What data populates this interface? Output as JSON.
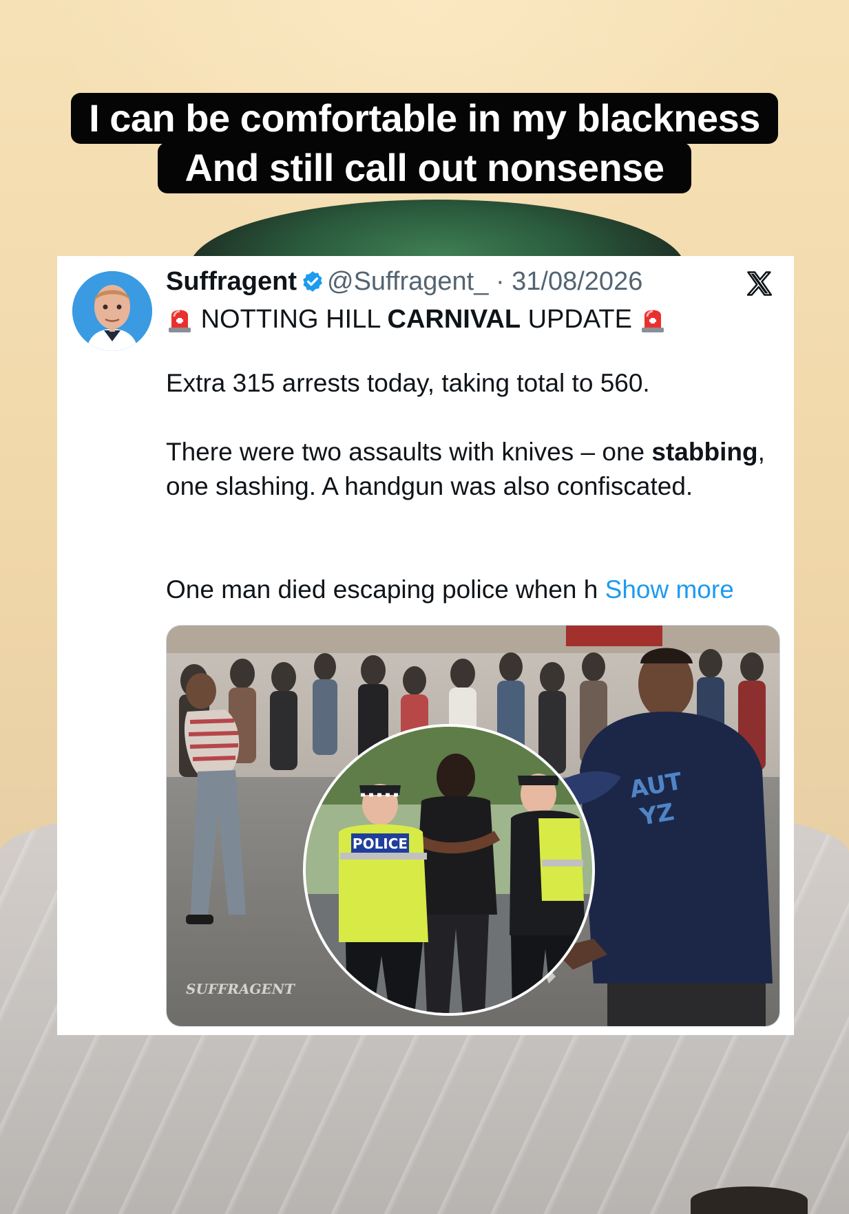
{
  "caption": {
    "line1": "I can be comfortable in my blackness",
    "line2": "And still call out nonsense"
  },
  "tweet": {
    "author_name": "Suffragent",
    "author_handle": "@Suffragent_",
    "date": "· 31/08/2026",
    "headline_part1": "NOTTING HILL ",
    "headline_bold": "CARNIVAL",
    "headline_part2": " UPDATE",
    "paragraph1": "Extra 315 arrests today, taking total to 560.",
    "paragraph2_part1": "There were two assaults with knives – one ",
    "paragraph2_bold": "stabbing",
    "paragraph2_part2": ", one slashing. A handgun was also confiscated.",
    "paragraph3": "One man died escaping police when h",
    "show_more": "Show more",
    "image_watermark": "SUFFRAGENT",
    "police_label": "POLICE"
  },
  "icons": {
    "verified": "verified-badge-icon",
    "x_logo": "x-logo-icon",
    "siren": "siren-emoji-icon"
  },
  "colors": {
    "caption_bg": "#050505",
    "caption_text": "#ffffff",
    "link": "#1d9bf0",
    "verified": "#1d9bf0",
    "secondary_text": "#536471"
  }
}
